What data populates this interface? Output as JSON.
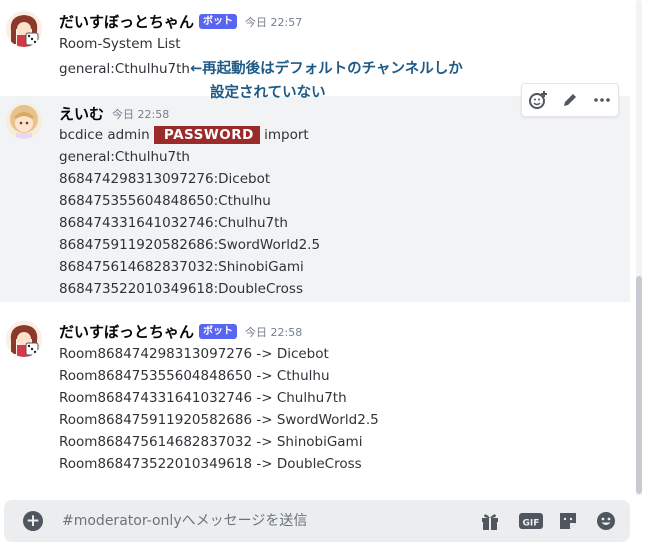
{
  "messages": [
    {
      "username": "だいすぼっとちゃん",
      "bot_tag": "ボット",
      "timestamp": "今日 22:57",
      "lines": [
        "Room-System List",
        "general:Cthulhu7th"
      ]
    },
    {
      "username": "えいむ",
      "timestamp": "今日 22:58",
      "command": {
        "before": "bcdice admin ",
        "redacted": "PASSWORD",
        "after": " import"
      },
      "lines": [
        "general:Cthulhu7th",
        "868474298313097276:Dicebot",
        "868475355604848650:Cthulhu",
        "868474331641032746:Chulhu7th",
        "868475911920582686:SwordWorld2.5",
        "868475614682837032:ShinobiGami",
        "868473522010349618:DoubleCross"
      ]
    },
    {
      "username": "だいすぼっとちゃん",
      "bot_tag": "ボット",
      "timestamp": "今日 22:58",
      "lines": [
        "Room868474298313097276 -> Dicebot",
        "Room868475355604848650 -> Cthulhu",
        "Room868474331641032746 -> Chulhu7th",
        "Room868475911920582686 -> SwordWorld2.5",
        "Room868475614682837032 -> ShinobiGami",
        "Room868473522010349618 -> DoubleCross"
      ]
    }
  ],
  "annotation": {
    "line1": "←再起動後はデフォルトのチャンネルしか",
    "line2": "設定されていない"
  },
  "composer": {
    "placeholder": "#moderator-onlyへメッセージを送信"
  },
  "icons": {
    "toolbar": [
      "add-reaction-icon",
      "edit-pencil-icon",
      "more-options-icon"
    ],
    "composer": [
      "gift-icon",
      "gif-icon",
      "sticker-icon",
      "emoji-icon"
    ]
  },
  "colors": {
    "bot_tag": "#5865f2",
    "annotation": "#1e5a86",
    "redaction": "#9b2b2b"
  }
}
